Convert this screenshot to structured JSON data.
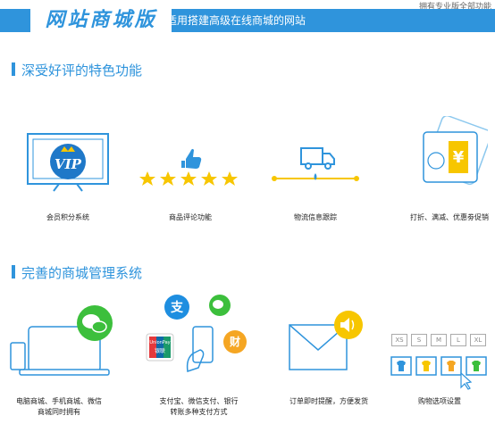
{
  "header": {
    "top_note": "拥有专业版全部功能",
    "title": "网站商城版",
    "description": "适用搭建高级在线商城的网站"
  },
  "section1": {
    "title": "深受好评的特色功能",
    "features": [
      {
        "label": "会员积分系统",
        "icon": "vip-monitor-icon"
      },
      {
        "label": "商品评论功能",
        "icon": "thumbs-up-stars-icon"
      },
      {
        "label": "物流信息跟踪",
        "icon": "delivery-truck-icon"
      },
      {
        "label": "打折、满减、优惠劵促销",
        "icon": "coupon-yen-icon"
      }
    ]
  },
  "section2": {
    "title": "完善的商城管理系统",
    "features": [
      {
        "label_line1": "电脑商城、手机商城、微信",
        "label_line2": "商城同时拥有",
        "icon": "devices-wechat-icon"
      },
      {
        "label_line1": "支付宝、微信支付、银行",
        "label_line2": "转账多种支付方式",
        "icon": "payment-methods-icon",
        "badges": {
          "alipay": "支",
          "unionpay": "UnionPay",
          "unionpay_sub": "银联",
          "cai": "财"
        }
      },
      {
        "label_line1": "订单即时提醒，方便发货",
        "label_line2": "",
        "icon": "envelope-notify-icon"
      },
      {
        "label_line1": "购物选项设置",
        "label_line2": "",
        "icon": "shopping-options-icon",
        "sizes": [
          "XS",
          "S",
          "M",
          "L",
          "XL"
        ]
      }
    ]
  },
  "colors": {
    "accent": "#2f94dc",
    "gold": "#f7c600",
    "green": "#3cbf3c",
    "orange": "#f5a623",
    "red": "#e4393c"
  }
}
